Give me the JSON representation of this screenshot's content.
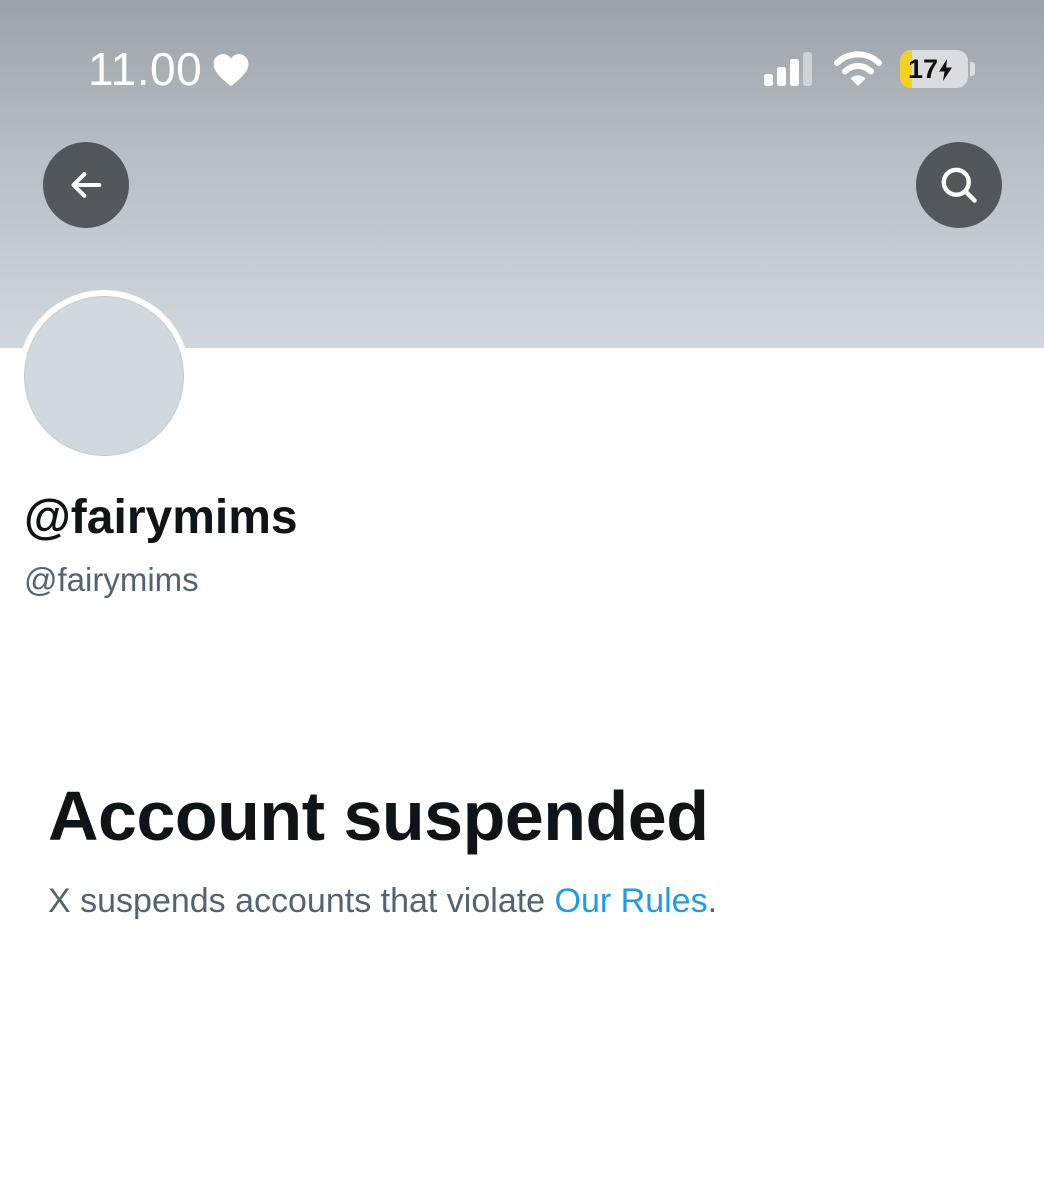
{
  "status_bar": {
    "time": "11.00",
    "battery_level": "17",
    "battery_fraction": 0.17,
    "icons": [
      "heart-icon",
      "signal-icon",
      "wifi-icon",
      "battery-icon",
      "charging-bolt-icon"
    ]
  },
  "nav": {
    "back_icon": "arrow-left-icon",
    "search_icon": "search-icon"
  },
  "profile": {
    "display_name": "@fairymims",
    "handle": "@fairymims"
  },
  "notice": {
    "title": "Account suspended",
    "text_before_link": "X suspends accounts that violate ",
    "link_text": "Our Rules",
    "text_after_link": "."
  },
  "colors": {
    "banner_top": "#9ba3a8",
    "banner_bottom": "#d0d7dd",
    "link": "#1d9bf0",
    "primary_text": "#0f1419",
    "secondary_text": "#536471",
    "avatar_placeholder": "#cfd9de",
    "battery_fill": "#f4d21a"
  }
}
